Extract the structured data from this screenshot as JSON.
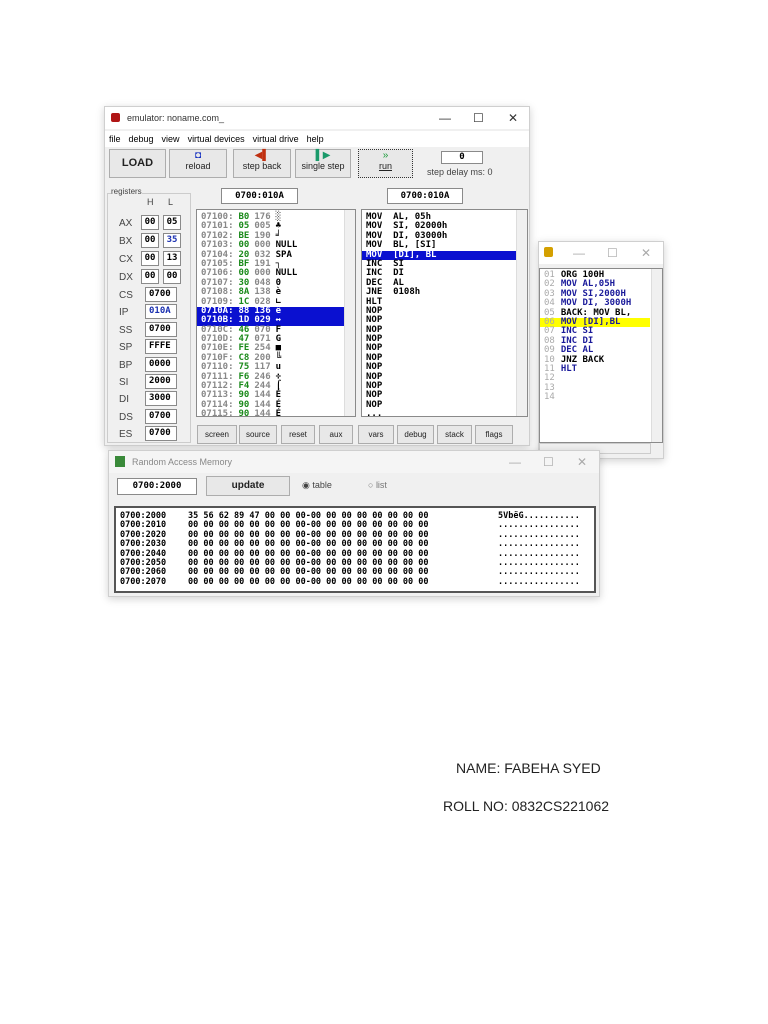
{
  "emulator": {
    "title": "emulator: noname.com_",
    "menu": [
      "file",
      "debug",
      "view",
      "virtual devices",
      "virtual drive",
      "help"
    ],
    "toolbar": {
      "load": "LOAD",
      "reload": "reload",
      "step_back": "step back",
      "single_step": "single step",
      "run": "run",
      "step_delay_value": "0",
      "step_delay_label": "step delay ms: 0"
    },
    "registers_label": "registers",
    "h": "H",
    "l": "L",
    "registers": [
      {
        "name": "AX",
        "h": "00",
        "l": "05"
      },
      {
        "name": "BX",
        "h": "00",
        "l": "35"
      },
      {
        "name": "CX",
        "h": "00",
        "l": "13"
      },
      {
        "name": "DX",
        "h": "00",
        "l": "00"
      }
    ],
    "seg_registers": [
      {
        "name": "CS",
        "v": "0700"
      },
      {
        "name": "IP",
        "v": "010A"
      },
      {
        "name": "SS",
        "v": "0700"
      },
      {
        "name": "SP",
        "v": "FFFE"
      },
      {
        "name": "BP",
        "v": "0000"
      },
      {
        "name": "SI",
        "v": "2000"
      },
      {
        "name": "DI",
        "v": "3000"
      },
      {
        "name": "DS",
        "v": "0700"
      },
      {
        "name": "ES",
        "v": "0700"
      }
    ],
    "mem_address": "0700:010A",
    "dis_address": "0700:010A",
    "memory": [
      [
        "07100:",
        "B0",
        "176",
        "░"
      ],
      [
        "07101:",
        "05",
        "005",
        "♣"
      ],
      [
        "07102:",
        "BE",
        "190",
        "╛"
      ],
      [
        "07103:",
        "00",
        "000",
        "NULL"
      ],
      [
        "07104:",
        "20",
        "032",
        "SPA"
      ],
      [
        "07105:",
        "BF",
        "191",
        "┐"
      ],
      [
        "07106:",
        "00",
        "000",
        "NULL"
      ],
      [
        "07107:",
        "30",
        "048",
        "0"
      ],
      [
        "07108:",
        "8A",
        "138",
        "è"
      ],
      [
        "07109:",
        "1C",
        "028",
        "∟"
      ],
      [
        "0710A:",
        "88",
        "136",
        "ê"
      ],
      [
        "0710B:",
        "1D",
        "029",
        "↔"
      ],
      [
        "0710C:",
        "46",
        "070",
        "F"
      ],
      [
        "0710D:",
        "47",
        "071",
        "G"
      ],
      [
        "0710E:",
        "FE",
        "254",
        "■"
      ],
      [
        "0710F:",
        "C8",
        "200",
        "╚"
      ],
      [
        "07110:",
        "75",
        "117",
        "u"
      ],
      [
        "07111:",
        "F6",
        "246",
        "÷"
      ],
      [
        "07112:",
        "F4",
        "244",
        "⌠"
      ],
      [
        "07113:",
        "90",
        "144",
        "É"
      ],
      [
        "07114:",
        "90",
        "144",
        "É"
      ],
      [
        "07115:",
        "90",
        "144",
        "É"
      ]
    ],
    "disasm": [
      "MOV  AL, 05h",
      "MOV  SI, 02000h",
      "MOV  DI, 03000h",
      "MOV  BL, [SI]",
      "MOV  [DI], BL",
      "INC  SI",
      "INC  DI",
      "DEC  AL",
      "JNE  0108h",
      "HLT",
      "NOP",
      "NOP",
      "NOP",
      "NOP",
      "NOP",
      "NOP",
      "NOP",
      "NOP",
      "NOP",
      "NOP",
      "NOP",
      "..."
    ],
    "bottom_buttons": [
      "screen",
      "source",
      "reset",
      "aux",
      "vars",
      "debug",
      "stack",
      "flags"
    ]
  },
  "source": {
    "lines": [
      [
        "01",
        "ORG 100H"
      ],
      [
        "02",
        "MOV AL,05H"
      ],
      [
        "03",
        "MOV SI,2000H"
      ],
      [
        "04",
        "MOV DI, 3000H"
      ],
      [
        "05",
        "BACK: MOV BL,"
      ],
      [
        "06",
        "MOV [DI],BL"
      ],
      [
        "07",
        "INC SI"
      ],
      [
        "08",
        "INC DI"
      ],
      [
        "09",
        "DEC AL"
      ],
      [
        "10",
        "JNZ BACK"
      ],
      [
        "11",
        "HLT"
      ],
      [
        "12",
        ""
      ],
      [
        "13",
        ""
      ],
      [
        "14",
        ""
      ]
    ]
  },
  "ram": {
    "title": "Random Access Memory",
    "address": "0700:2000",
    "update": "update",
    "table": "table",
    "list": "list",
    "rows": [
      [
        "0700:2000",
        "35 56 62 89 47 00 00 00-00 00 00 00 00 00 00 00",
        "5VbëG..........."
      ],
      [
        "0700:2010",
        "00 00 00 00 00 00 00 00-00 00 00 00 00 00 00 00",
        "................"
      ],
      [
        "0700:2020",
        "00 00 00 00 00 00 00 00-00 00 00 00 00 00 00 00",
        "................"
      ],
      [
        "0700:2030",
        "00 00 00 00 00 00 00 00-00 00 00 00 00 00 00 00",
        "................"
      ],
      [
        "0700:2040",
        "00 00 00 00 00 00 00 00-00 00 00 00 00 00 00 00",
        "................"
      ],
      [
        "0700:2050",
        "00 00 00 00 00 00 00 00-00 00 00 00 00 00 00 00",
        "................"
      ],
      [
        "0700:2060",
        "00 00 00 00 00 00 00 00-00 00 00 00 00 00 00 00",
        "................"
      ],
      [
        "0700:2070",
        "00 00 00 00 00 00 00 00-00 00 00 00 00 00 00 00",
        "................"
      ]
    ]
  },
  "doc": {
    "name": "NAME: FABEHA SYED",
    "roll": "ROLL NO: 0832CS221062"
  },
  "colors": {
    "selection": "#0a10d0",
    "highlight": "#ffff00",
    "green": "#1a8a1a"
  }
}
